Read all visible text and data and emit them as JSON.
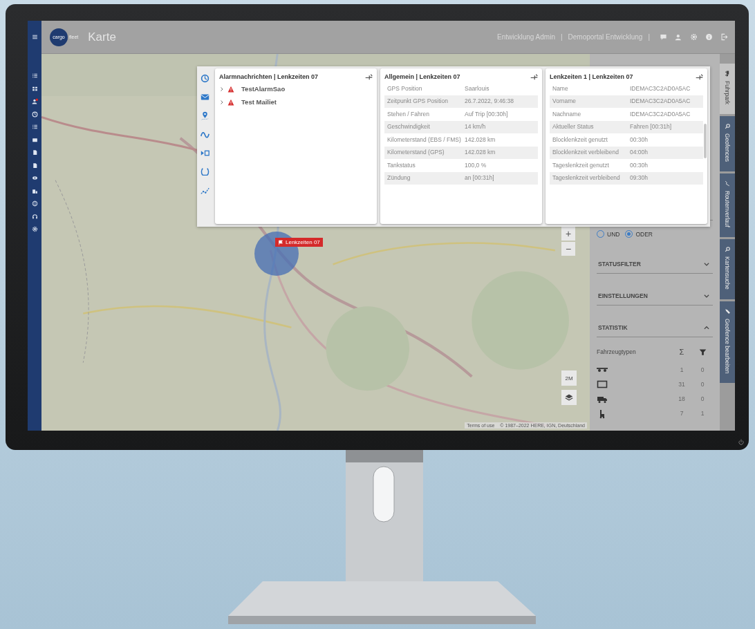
{
  "nav_rail": {
    "items": [
      {
        "kind": "menu",
        "alert": false
      },
      {
        "kind": "list",
        "alert": false
      },
      {
        "kind": "grid",
        "alert": false
      },
      {
        "kind": "person",
        "alert": true
      },
      {
        "kind": "clock",
        "alert": false
      },
      {
        "kind": "list",
        "alert": false
      },
      {
        "kind": "card",
        "alert": false
      },
      {
        "kind": "doc",
        "alert": false
      },
      {
        "kind": "doc",
        "alert": false
      },
      {
        "kind": "eye",
        "alert": false
      },
      {
        "kind": "building",
        "alert": false
      },
      {
        "kind": "globe",
        "alert": false
      },
      {
        "kind": "headset",
        "alert": false
      },
      {
        "kind": "gear",
        "alert": false
      }
    ]
  },
  "header": {
    "logo": {
      "mark": "cargo",
      "word": "fleet"
    },
    "title": "Karte",
    "user": "Entwicklung Admin",
    "user_separator": "|",
    "portal": "Demoportal Entwicklung",
    "portal_separator": "|"
  },
  "map": {
    "marker_label": "Lenkzeiten 07",
    "zoom_in": "+",
    "zoom_out": "−",
    "scale_button": "2M",
    "terms": "Terms of use",
    "copyright": "© 1987–2022 HERE, IGN, Deutschland"
  },
  "cards": [
    {
      "kind": "tree",
      "title": "Alarmnachrichten | Lenkzeiten 07",
      "items": [
        {
          "label": "TestAlarmSao",
          "expanded": false
        },
        {
          "label": "Test Mailiet",
          "expanded": false
        }
      ]
    },
    {
      "kind": "table",
      "title": "Allgemein | Lenkzeiten 07",
      "rows": [
        {
          "label": "GPS Position",
          "value": "Saarlouis"
        },
        {
          "label": "Zeitpunkt GPS Position",
          "value": "26.7.2022, 9:46:38"
        },
        {
          "label": "Stehen / Fahren",
          "value": "Auf Trip [00:30h]"
        },
        {
          "label": "Geschwindigkeit",
          "value": "14 km/h"
        },
        {
          "label": "Kilometerstand (EBS / FMS)",
          "value": "142.028 km"
        },
        {
          "label": "Kilometerstand (GPS)",
          "value": "142.028 km"
        },
        {
          "label": "Tankstatus",
          "value": "100,0 %"
        },
        {
          "label": "Zündung",
          "value": "an [00:31h]"
        }
      ]
    },
    {
      "kind": "table",
      "title": "Lenkzeiten 1 | Lenkzeiten 07",
      "rows": [
        {
          "label": "Name",
          "value": "IDEMAC3C2AD0A5AC"
        },
        {
          "label": "Vorname",
          "value": "IDEMAC3C2AD0A5AC"
        },
        {
          "label": "Nachname",
          "value": "IDEMAC3C2AD0A5AC"
        },
        {
          "label": "Aktueller Status",
          "value": "Fahren [00:31h]"
        },
        {
          "label": "Blocklenkzeit genutzt",
          "value": "00:30h"
        },
        {
          "label": "Blocklenkzeit verbleibend",
          "value": "04:00h"
        },
        {
          "label": "Tageslenkzeit genutzt",
          "value": "00:30h"
        },
        {
          "label": "Tageslenkzeit verbleibend",
          "value": "09:30h"
        }
      ]
    }
  ],
  "filter_panel": {
    "logic": [
      {
        "label": "UND",
        "selected": false
      },
      {
        "label": "ODER",
        "selected": true
      }
    ],
    "sections": [
      {
        "title": "STATUSFILTER",
        "expanded": false
      },
      {
        "title": "EINSTELLUNGEN",
        "expanded": false
      },
      {
        "title": "STATISTIK",
        "expanded": true
      }
    ],
    "statistics": {
      "label_column": "Fahrzeugtypen",
      "total_column": "Σ",
      "rows": [
        {
          "kind": "trailer",
          "total": "1",
          "filtered": "0"
        },
        {
          "kind": "box",
          "total": "31",
          "filtered": "0"
        },
        {
          "kind": "truck",
          "total": "18",
          "filtered": "0"
        },
        {
          "kind": "tractor",
          "total": "7",
          "filtered": "1"
        }
      ]
    }
  },
  "side_tabs": [
    {
      "label": "Fuhrpark",
      "kind": "truck",
      "selected": true
    },
    {
      "label": "Geofences",
      "kind": "search",
      "selected": false
    },
    {
      "label": "Routenverlauf",
      "kind": "route",
      "selected": false
    },
    {
      "label": "Kartensuche",
      "kind": "search",
      "selected": false
    },
    {
      "label": "Geofence bearbeiten",
      "kind": "pencil",
      "selected": false
    }
  ]
}
